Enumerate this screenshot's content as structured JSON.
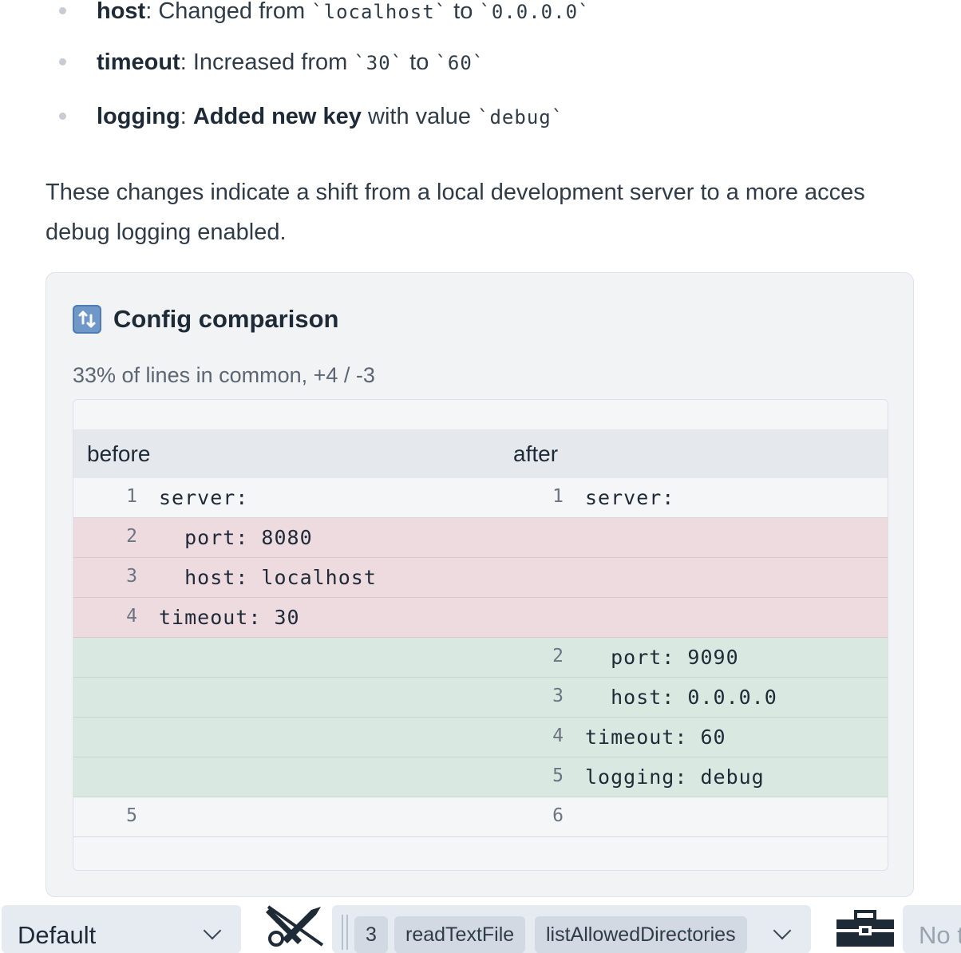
{
  "bullets": [
    {
      "key": "host",
      "sep": ": ",
      "text": "Changed from ",
      "code1": "`localhost`",
      "mid": " to ",
      "code2": "`0.0.0.0`"
    },
    {
      "key": "timeout",
      "sep": ": ",
      "text": "Increased from ",
      "code1": "`30`",
      "mid": " to ",
      "code2": "`60`"
    },
    {
      "key": "logging",
      "sep": ": ",
      "bold_text": "Added new key",
      "text": " with value ",
      "code1": "`debug`"
    }
  ],
  "summary": {
    "line1": "These changes indicate a shift from a local development server to a more acces",
    "line2": "debug logging enabled."
  },
  "card": {
    "icon": "refresh-icon",
    "icon_glyph": "⤴",
    "title": "Config comparison",
    "subtitle": "33% of lines in common, +4 / -3",
    "before_label": "before",
    "after_label": "after",
    "rows": [
      {
        "type": "ctx",
        "left_num": "1",
        "left": "server:",
        "right_num": "1",
        "right": "server:"
      },
      {
        "type": "del",
        "left_num": "2",
        "left": "  port: 8080",
        "right_num": "",
        "right": ""
      },
      {
        "type": "del",
        "left_num": "3",
        "left": "  host: localhost",
        "right_num": "",
        "right": ""
      },
      {
        "type": "del",
        "left_num": "4",
        "left": "timeout: 30",
        "right_num": "",
        "right": ""
      },
      {
        "type": "add",
        "left_num": "",
        "left": "",
        "right_num": "2",
        "right": "  port: 9090"
      },
      {
        "type": "add",
        "left_num": "",
        "left": "",
        "right_num": "3",
        "right": "  host: 0.0.0.0"
      },
      {
        "type": "add",
        "left_num": "",
        "left": "",
        "right_num": "4",
        "right": "timeout: 60"
      },
      {
        "type": "add",
        "left_num": "",
        "left": "",
        "right_num": "5",
        "right": "logging: debug"
      },
      {
        "type": "ctx",
        "left_num": "5",
        "left": "",
        "right_num": "6",
        "right": ""
      }
    ]
  },
  "toolbar": {
    "mode": "Default",
    "tools_icon": "tools-disabled-icon",
    "tool_count": "3",
    "tool_chips": [
      "readTextFile",
      "listAllowedDirectories"
    ],
    "toolkit_icon": "toolbox-icon",
    "no_label": "No t"
  }
}
